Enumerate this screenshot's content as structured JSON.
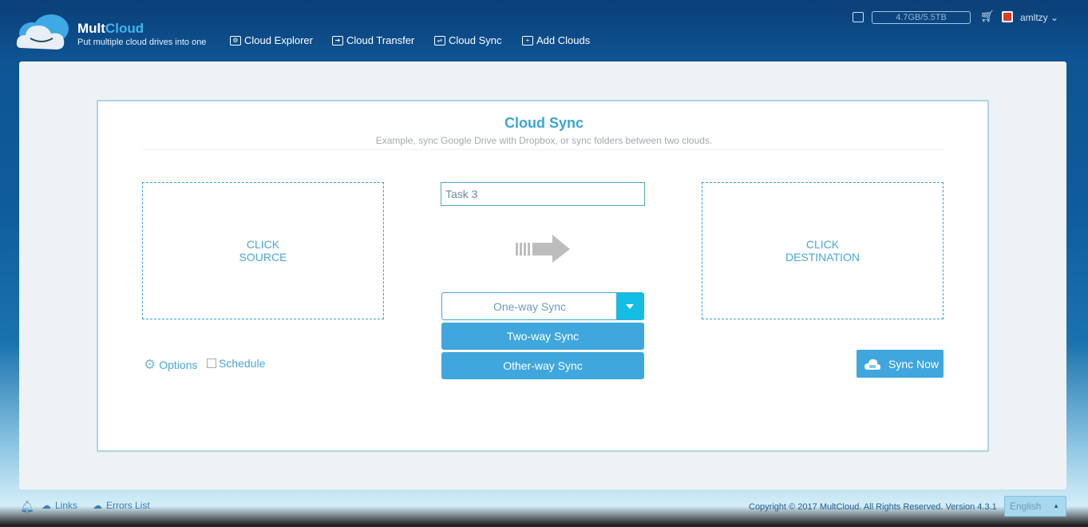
{
  "header": {
    "brand_a": "Mult",
    "brand_b": "Cloud",
    "tagline": "Put multiple cloud drives into one",
    "nav": [
      {
        "label": "Cloud Explorer",
        "icon": "gear-folder-icon"
      },
      {
        "label": "Cloud Transfer",
        "icon": "transfer-folder-icon"
      },
      {
        "label": "Cloud Sync",
        "icon": "sync-folder-icon"
      },
      {
        "label": "Add Clouds",
        "icon": "add-folder-icon"
      }
    ],
    "storage": "4.7GB/5.5TB",
    "username": "amltzy"
  },
  "main": {
    "title": "Cloud Sync",
    "subtitle": "Example, sync Google Drive with Dropbox, or sync folders between two clouds.",
    "source_line1": "CLICK",
    "source_line2": "SOURCE",
    "dest_line1": "CLICK",
    "dest_line2": "DESTINATION",
    "task_name": "Task 3",
    "sync_mode": "One-way Sync",
    "sync_options": [
      "Two-way Sync",
      "Other-way Sync"
    ],
    "options_label": "Options",
    "schedule_label": "Schedule",
    "sync_now_label": "Sync Now"
  },
  "footer": {
    "links": "Links",
    "errors": "Errors List",
    "copyright": "Copyright © 2017 MultCloud. All Rights Reserved. Version 4.3.1",
    "language": "English"
  },
  "colors": {
    "accent": "#3fa7dd",
    "dropdown_btn": "#14bde3"
  }
}
